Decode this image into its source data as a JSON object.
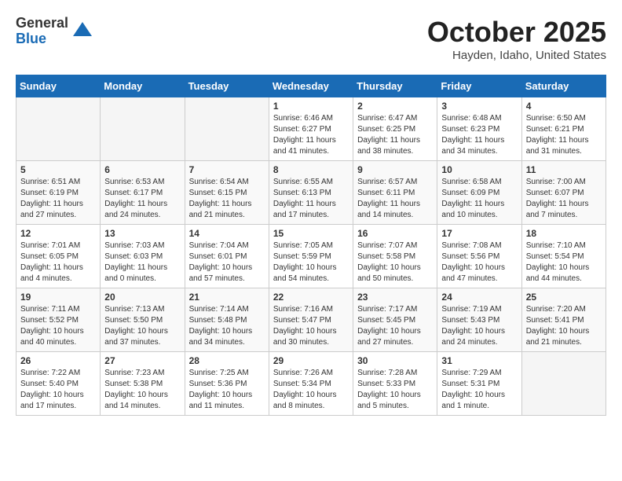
{
  "header": {
    "logo_general": "General",
    "logo_blue": "Blue",
    "month_title": "October 2025",
    "location": "Hayden, Idaho, United States"
  },
  "weekdays": [
    "Sunday",
    "Monday",
    "Tuesday",
    "Wednesday",
    "Thursday",
    "Friday",
    "Saturday"
  ],
  "weeks": [
    [
      {
        "day": "",
        "info": ""
      },
      {
        "day": "",
        "info": ""
      },
      {
        "day": "",
        "info": ""
      },
      {
        "day": "1",
        "info": "Sunrise: 6:46 AM\nSunset: 6:27 PM\nDaylight: 11 hours\nand 41 minutes."
      },
      {
        "day": "2",
        "info": "Sunrise: 6:47 AM\nSunset: 6:25 PM\nDaylight: 11 hours\nand 38 minutes."
      },
      {
        "day": "3",
        "info": "Sunrise: 6:48 AM\nSunset: 6:23 PM\nDaylight: 11 hours\nand 34 minutes."
      },
      {
        "day": "4",
        "info": "Sunrise: 6:50 AM\nSunset: 6:21 PM\nDaylight: 11 hours\nand 31 minutes."
      }
    ],
    [
      {
        "day": "5",
        "info": "Sunrise: 6:51 AM\nSunset: 6:19 PM\nDaylight: 11 hours\nand 27 minutes."
      },
      {
        "day": "6",
        "info": "Sunrise: 6:53 AM\nSunset: 6:17 PM\nDaylight: 11 hours\nand 24 minutes."
      },
      {
        "day": "7",
        "info": "Sunrise: 6:54 AM\nSunset: 6:15 PM\nDaylight: 11 hours\nand 21 minutes."
      },
      {
        "day": "8",
        "info": "Sunrise: 6:55 AM\nSunset: 6:13 PM\nDaylight: 11 hours\nand 17 minutes."
      },
      {
        "day": "9",
        "info": "Sunrise: 6:57 AM\nSunset: 6:11 PM\nDaylight: 11 hours\nand 14 minutes."
      },
      {
        "day": "10",
        "info": "Sunrise: 6:58 AM\nSunset: 6:09 PM\nDaylight: 11 hours\nand 10 minutes."
      },
      {
        "day": "11",
        "info": "Sunrise: 7:00 AM\nSunset: 6:07 PM\nDaylight: 11 hours\nand 7 minutes."
      }
    ],
    [
      {
        "day": "12",
        "info": "Sunrise: 7:01 AM\nSunset: 6:05 PM\nDaylight: 11 hours\nand 4 minutes."
      },
      {
        "day": "13",
        "info": "Sunrise: 7:03 AM\nSunset: 6:03 PM\nDaylight: 11 hours\nand 0 minutes."
      },
      {
        "day": "14",
        "info": "Sunrise: 7:04 AM\nSunset: 6:01 PM\nDaylight: 10 hours\nand 57 minutes."
      },
      {
        "day": "15",
        "info": "Sunrise: 7:05 AM\nSunset: 5:59 PM\nDaylight: 10 hours\nand 54 minutes."
      },
      {
        "day": "16",
        "info": "Sunrise: 7:07 AM\nSunset: 5:58 PM\nDaylight: 10 hours\nand 50 minutes."
      },
      {
        "day": "17",
        "info": "Sunrise: 7:08 AM\nSunset: 5:56 PM\nDaylight: 10 hours\nand 47 minutes."
      },
      {
        "day": "18",
        "info": "Sunrise: 7:10 AM\nSunset: 5:54 PM\nDaylight: 10 hours\nand 44 minutes."
      }
    ],
    [
      {
        "day": "19",
        "info": "Sunrise: 7:11 AM\nSunset: 5:52 PM\nDaylight: 10 hours\nand 40 minutes."
      },
      {
        "day": "20",
        "info": "Sunrise: 7:13 AM\nSunset: 5:50 PM\nDaylight: 10 hours\nand 37 minutes."
      },
      {
        "day": "21",
        "info": "Sunrise: 7:14 AM\nSunset: 5:48 PM\nDaylight: 10 hours\nand 34 minutes."
      },
      {
        "day": "22",
        "info": "Sunrise: 7:16 AM\nSunset: 5:47 PM\nDaylight: 10 hours\nand 30 minutes."
      },
      {
        "day": "23",
        "info": "Sunrise: 7:17 AM\nSunset: 5:45 PM\nDaylight: 10 hours\nand 27 minutes."
      },
      {
        "day": "24",
        "info": "Sunrise: 7:19 AM\nSunset: 5:43 PM\nDaylight: 10 hours\nand 24 minutes."
      },
      {
        "day": "25",
        "info": "Sunrise: 7:20 AM\nSunset: 5:41 PM\nDaylight: 10 hours\nand 21 minutes."
      }
    ],
    [
      {
        "day": "26",
        "info": "Sunrise: 7:22 AM\nSunset: 5:40 PM\nDaylight: 10 hours\nand 17 minutes."
      },
      {
        "day": "27",
        "info": "Sunrise: 7:23 AM\nSunset: 5:38 PM\nDaylight: 10 hours\nand 14 minutes."
      },
      {
        "day": "28",
        "info": "Sunrise: 7:25 AM\nSunset: 5:36 PM\nDaylight: 10 hours\nand 11 minutes."
      },
      {
        "day": "29",
        "info": "Sunrise: 7:26 AM\nSunset: 5:34 PM\nDaylight: 10 hours\nand 8 minutes."
      },
      {
        "day": "30",
        "info": "Sunrise: 7:28 AM\nSunset: 5:33 PM\nDaylight: 10 hours\nand 5 minutes."
      },
      {
        "day": "31",
        "info": "Sunrise: 7:29 AM\nSunset: 5:31 PM\nDaylight: 10 hours\nand 1 minute."
      },
      {
        "day": "",
        "info": ""
      }
    ]
  ]
}
